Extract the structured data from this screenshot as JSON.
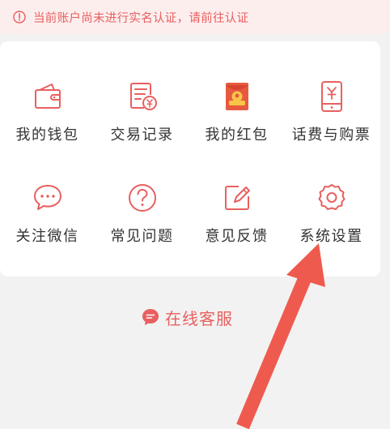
{
  "banner": {
    "icon": "alert-circle-icon",
    "text": "当前账户尚未进行实名认证，请前往认证"
  },
  "menu": {
    "items": [
      {
        "label": "我的钱包",
        "icon": "wallet-icon"
      },
      {
        "label": "交易记录",
        "icon": "transaction-record-icon"
      },
      {
        "label": "我的红包",
        "icon": "red-envelope-icon"
      },
      {
        "label": "话费与购票",
        "icon": "phone-bill-icon"
      },
      {
        "label": "关注微信",
        "icon": "chat-bubble-icon"
      },
      {
        "label": "常见问题",
        "icon": "question-icon"
      },
      {
        "label": "意见反馈",
        "icon": "feedback-edit-icon"
      },
      {
        "label": "系统设置",
        "icon": "gear-icon"
      }
    ]
  },
  "service": {
    "icon": "message-icon",
    "label": "在线客服"
  },
  "colors": {
    "accent": "#e8605f",
    "banner_bg": "#fdeeee",
    "page_bg": "#f2f2f2",
    "text": "#333333",
    "arrow": "#ef5a4f"
  }
}
